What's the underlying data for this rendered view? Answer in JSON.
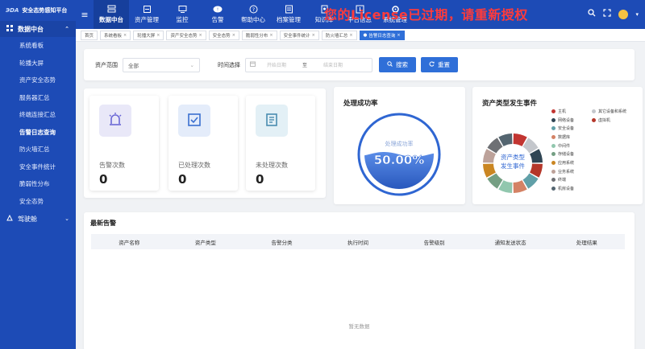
{
  "app": {
    "logo_mark": "ЭDA",
    "title": "安全态势感知平台"
  },
  "license_warning": "您的License已过期，请重新授权",
  "sidebar": {
    "group_label": "数据中台",
    "items": [
      {
        "label": "系统看板"
      },
      {
        "label": "轮播大屏"
      },
      {
        "label": "资产安全态势"
      },
      {
        "label": "服务器汇总"
      },
      {
        "label": "终端连接汇总"
      },
      {
        "label": "告警日志查询",
        "active": true
      },
      {
        "label": "防火墙汇总"
      },
      {
        "label": "安全事件统计"
      },
      {
        "label": "脆弱性分布"
      },
      {
        "label": "安全态势"
      }
    ],
    "bottom_label": "驾驶舱"
  },
  "topnav": {
    "items": [
      {
        "label": "数据中台",
        "icon": "data-center-icon",
        "active": true
      },
      {
        "label": "资产管理",
        "icon": "asset-icon"
      },
      {
        "label": "监控",
        "icon": "monitor-icon"
      },
      {
        "label": "告警",
        "icon": "alarm-icon"
      },
      {
        "label": "帮助中心",
        "icon": "help-icon"
      },
      {
        "label": "档案管理",
        "icon": "archive-icon"
      },
      {
        "label": "知识库",
        "icon": "knowledge-icon"
      },
      {
        "label": "平台信息",
        "icon": "platform-icon"
      },
      {
        "label": "系统管理",
        "icon": "system-icon"
      }
    ]
  },
  "tabs": [
    {
      "label": "首页",
      "closable": false
    },
    {
      "label": "系统看板",
      "closable": true
    },
    {
      "label": "轮播大屏",
      "closable": true
    },
    {
      "label": "资产安全态势",
      "closable": true
    },
    {
      "label": "安全态势",
      "closable": true
    },
    {
      "label": "脆弱性分布",
      "closable": true
    },
    {
      "label": "安全事件统计",
      "closable": true
    },
    {
      "label": "防火墙汇总",
      "closable": true
    },
    {
      "label": "告警日志查询",
      "closable": true,
      "active": true
    }
  ],
  "filter": {
    "asset_range_label": "资产范围",
    "asset_range_value": "全部",
    "time_label": "时间选择",
    "start_placeholder": "开始日期",
    "range_sep": "至",
    "end_placeholder": "结束日期",
    "search_label": "搜索",
    "reset_label": "重置"
  },
  "stats": [
    {
      "label": "告警次数",
      "value": "0",
      "icon": "alarm-light-icon",
      "color": "#6b68d6",
      "bg": "#e9e8f8"
    },
    {
      "label": "已处理次数",
      "value": "0",
      "icon": "checkbox-icon",
      "color": "#3a6fd0",
      "bg": "#e4ecfa"
    },
    {
      "label": "未处理次数",
      "value": "0",
      "icon": "document-icon",
      "color": "#4a8db0",
      "bg": "#e3f0f6"
    }
  ],
  "success_rate": {
    "title": "处理成功率",
    "inner_label": "处理成功率",
    "value_text": "50.00%",
    "value": 0.5,
    "color": "#2f66d2"
  },
  "asset_types": {
    "title": "资产类型发生事件",
    "center_label_1": "资产类型",
    "center_label_2": "发生事件",
    "legend": [
      {
        "label": "主机",
        "color": "#c23531"
      },
      {
        "label": "其它设备和系统",
        "color": "#c4c7cc"
      },
      {
        "label": "网络设备",
        "color": "#2f4554"
      },
      {
        "label": "虚拟机",
        "color": "#b5372a"
      },
      {
        "label": "安全设备",
        "color": "#61a0a8"
      },
      {
        "label": "数据库",
        "color": "#d48265"
      },
      {
        "label": "中间件",
        "color": "#91c7ae"
      },
      {
        "label": "存储设备",
        "color": "#749f83"
      },
      {
        "label": "应用系统",
        "color": "#ca8622"
      },
      {
        "label": "业务系统",
        "color": "#bda29a"
      },
      {
        "label": "终端",
        "color": "#6e7074"
      },
      {
        "label": "机房设备",
        "color": "#546570"
      }
    ]
  },
  "latest_alerts": {
    "title": "最新告警",
    "columns": [
      "资产名称",
      "资产类型",
      "告警分类",
      "执行时间",
      "告警级别",
      "通知发送状态",
      "处理结果"
    ],
    "empty_text": "暂无数据"
  }
}
